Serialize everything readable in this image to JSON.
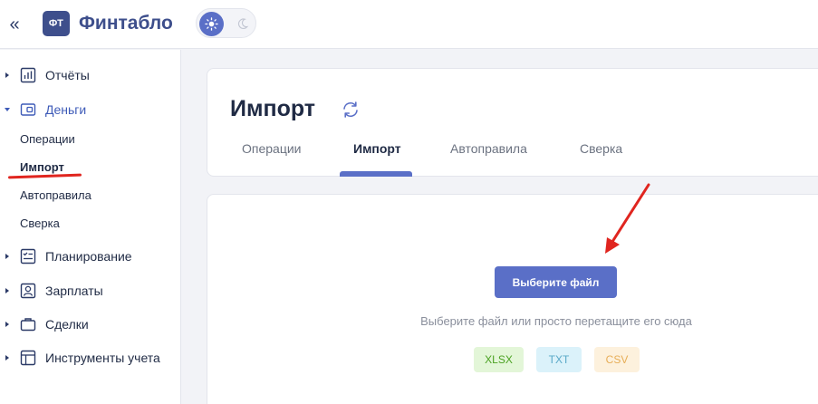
{
  "header": {
    "collapse_symbol": "«",
    "logo_mark": "ФТ",
    "app_name": "Финтабло",
    "theme_toggle": {
      "active": "light",
      "options": [
        "light",
        "dark"
      ]
    }
  },
  "sidebar": {
    "groups": [
      {
        "label": "Отчёты",
        "icon": "reports-icon",
        "expanded": false
      },
      {
        "label": "Деньги",
        "icon": "wallet-icon",
        "expanded": true,
        "children": [
          "Операции",
          "Импорт",
          "Автоправила",
          "Сверка"
        ],
        "selected_child": "Импорт"
      },
      {
        "label": "Планирование",
        "icon": "planning-icon",
        "expanded": false
      },
      {
        "label": "Зарплаты",
        "icon": "salary-icon",
        "expanded": false
      },
      {
        "label": "Сделки",
        "icon": "briefcase-icon",
        "expanded": false
      },
      {
        "label": "Инструменты учета",
        "icon": "table-icon",
        "expanded": false
      }
    ]
  },
  "page": {
    "title": "Импорт",
    "tabs": [
      "Операции",
      "Импорт",
      "Автоправила",
      "Сверка"
    ],
    "active_tab": "Импорт"
  },
  "upload": {
    "button_label": "Выберите файл",
    "hint": "Выберите файл или просто перетащите его сюда",
    "formats": [
      "XLSX",
      "TXT",
      "CSV"
    ]
  },
  "colors": {
    "accent": "#5a6fc7",
    "brand": "#3e4f8c",
    "annotation": "#e0251f",
    "xlsx": "#4ba222",
    "txt": "#5aa9c8",
    "csv": "#e7ae58"
  }
}
